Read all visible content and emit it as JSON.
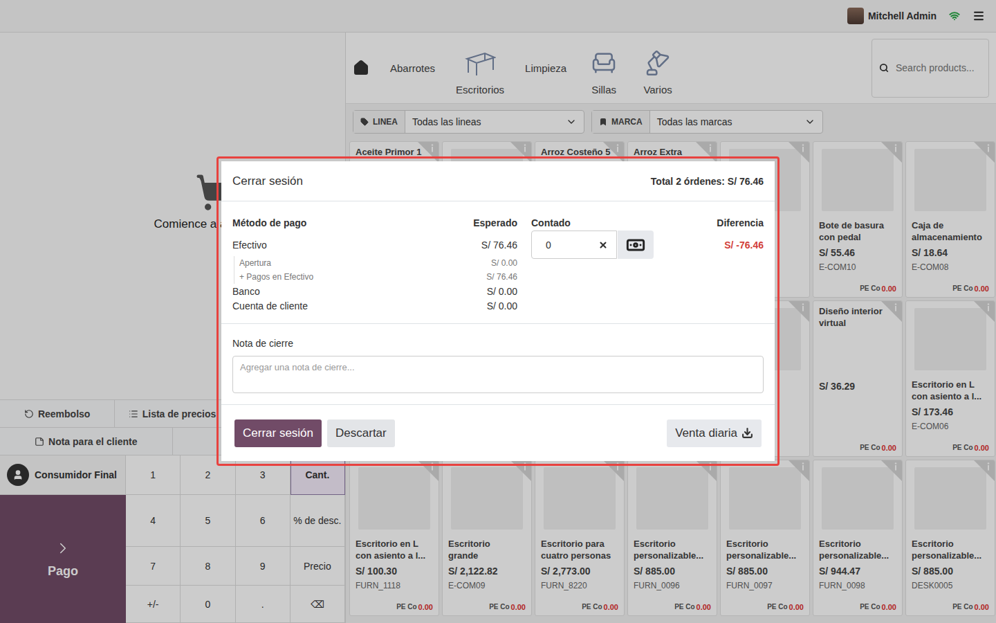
{
  "top_bar": {
    "user": "Mitchell Admin"
  },
  "cart": {
    "empty_message": "Comience a agregar pr"
  },
  "control_buttons": [
    {
      "label": "Reembolso",
      "kind": "refund"
    },
    {
      "label": "Lista de precios",
      "kind": "pricelist"
    },
    {
      "label": "Nota para el cliente",
      "kind": "note"
    }
  ],
  "customer": {
    "label": "Consumidor Final"
  },
  "payment_button": {
    "label": "Pago"
  },
  "numpad": [
    {
      "label": "1",
      "selected": false
    },
    {
      "label": "2",
      "selected": false
    },
    {
      "label": "3",
      "selected": false
    },
    {
      "label": "Cant.",
      "selected": true
    },
    {
      "label": "4",
      "selected": false
    },
    {
      "label": "5",
      "selected": false
    },
    {
      "label": "6",
      "selected": false
    },
    {
      "label": "% de desc.",
      "selected": false
    },
    {
      "label": "7",
      "selected": false
    },
    {
      "label": "8",
      "selected": false
    },
    {
      "label": "9",
      "selected": false
    },
    {
      "label": "Precio",
      "selected": false
    },
    {
      "label": "+/-",
      "selected": false
    },
    {
      "label": "0",
      "selected": false
    },
    {
      "label": ".",
      "selected": false
    },
    {
      "label": "⌫",
      "selected": false
    }
  ],
  "categories": [
    {
      "label": "Abarrotes",
      "kind": "text"
    },
    {
      "label": "Escritorios",
      "kind": "desk"
    },
    {
      "label": "Limpieza",
      "kind": "text"
    },
    {
      "label": "Sillas",
      "kind": "chair"
    },
    {
      "label": "Varios",
      "kind": "lamp"
    }
  ],
  "search": {
    "placeholder": "Search products..."
  },
  "filters": [
    {
      "label": "LINEA",
      "value": "Todas las lineas",
      "kind": "tag"
    },
    {
      "label": "MARCA",
      "value": "Todas las marcas",
      "kind": "bookmark"
    }
  ],
  "products": [
    {
      "kind": "text",
      "name": "Aceite Primor 1"
    },
    {
      "kind": "image"
    },
    {
      "kind": "text",
      "name": "Arroz Costeño 5"
    },
    {
      "kind": "text",
      "name": "Arroz Extra"
    },
    {
      "kind": "image"
    },
    {
      "kind": "image",
      "name": "Bote de basura con pedal",
      "price": "S/ 55.46",
      "code": "E-COM10",
      "tag_label": "PE Co",
      "tag_value": "0.00"
    },
    {
      "kind": "image",
      "name": "Caja de almacenamiento",
      "price": "S/ 18.64",
      "code": "E-COM08",
      "tag_label": "PE Co",
      "tag_value": "0.00"
    },
    {
      "kind": "image"
    },
    {
      "kind": "image"
    },
    {
      "kind": "image"
    },
    {
      "kind": "image"
    },
    {
      "kind": "image"
    },
    {
      "kind": "text",
      "name": "Diseño interior virtual",
      "price": "S/ 36.29",
      "tag_label": "PE Co",
      "tag_value": "0.00"
    },
    {
      "kind": "image",
      "name": "Escritorio en L con asiento a l...",
      "price": "S/ 173.46",
      "code": "E-COM06",
      "tag_label": "PE Co",
      "tag_value": "0.00"
    },
    {
      "kind": "image",
      "name": "Escritorio en L con asiento a l...",
      "price": "S/ 100.30",
      "code": "FURN_1118",
      "tag_label": "PE Co",
      "tag_value": "0.00"
    },
    {
      "kind": "image",
      "name": "Escritorio grande",
      "price": "S/ 2,122.82",
      "code": "E-COM09",
      "tag_label": "PE Co",
      "tag_value": "0.00"
    },
    {
      "kind": "image",
      "name": "Escritorio para cuatro personas",
      "price": "S/ 2,773.00",
      "code": "FURN_8220",
      "tag_label": "PE Co",
      "tag_value": "0.00"
    },
    {
      "kind": "image",
      "name": "Escritorio personalizable...",
      "price": "S/ 885.00",
      "code": "FURN_0096",
      "tag_label": "PE Co",
      "tag_value": "0.00"
    },
    {
      "kind": "image",
      "name": "Escritorio personalizable...",
      "price": "S/ 885.00",
      "code": "FURN_0097",
      "tag_label": "PE Co",
      "tag_value": "0.00"
    },
    {
      "kind": "image",
      "name": "Escritorio personalizable...",
      "price": "S/ 944.47",
      "code": "FURN_0098",
      "tag_label": "PE Co",
      "tag_value": "0.00"
    },
    {
      "kind": "image",
      "name": "Escritorio personalizable...",
      "price": "S/ 885.00",
      "code": "DESK0005",
      "tag_label": "PE Co",
      "tag_value": "0.00"
    }
  ],
  "dialog": {
    "title": "Cerrar sesión",
    "total": "Total 2 órdenes: S/ 76.46",
    "columns": [
      "Método de pago",
      "Esperado",
      "Contado",
      "Diferencia"
    ],
    "cash": {
      "method": "Efectivo",
      "expected": "S/ 76.46",
      "counted": "0",
      "difference": "S/ -76.46",
      "details": [
        {
          "label": "Apertura",
          "amount": "S/ 0.00"
        },
        {
          "label": "+ Pagos en Efectivo",
          "amount": "S/ 76.46"
        }
      ]
    },
    "other_methods": [
      {
        "method": "Banco",
        "expected": "S/ 0.00"
      },
      {
        "method": "Cuenta de cliente",
        "expected": "S/ 0.00"
      }
    ],
    "note_label": "Nota de cierre",
    "note_placeholder": "Agregar una nota de cierre...",
    "buttons": [
      {
        "label": "Cerrar sesión",
        "kind": "primary"
      },
      {
        "label": "Descartar",
        "kind": "secondary"
      },
      {
        "label": "Venta diaria",
        "kind": "download"
      }
    ]
  }
}
